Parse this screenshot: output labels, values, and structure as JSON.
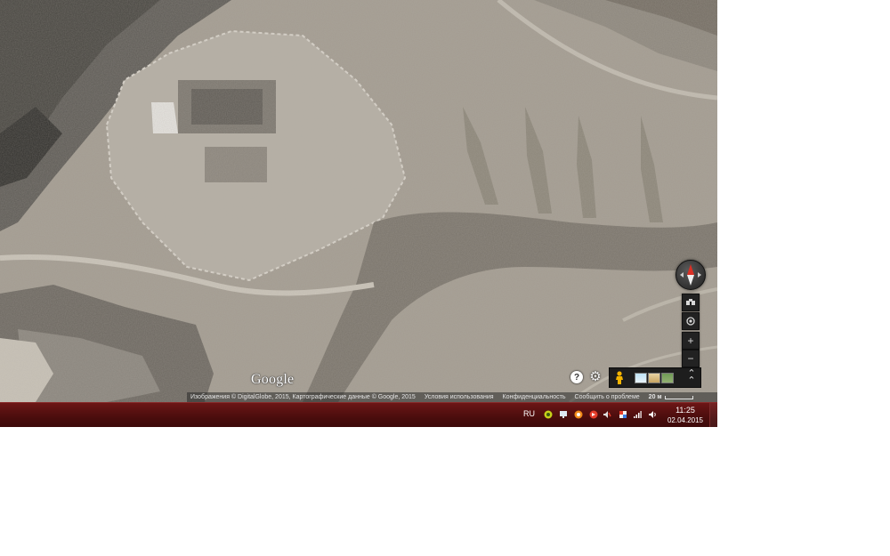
{
  "map": {
    "provider_logo": "Google",
    "attribution": {
      "imagery": "Изображения © DigitalGlobe, 2015, Картографические данные © Google, 2015",
      "terms": "Условия использования",
      "privacy": "Конфиденциальность",
      "report": "Сообщить о проблеме",
      "scale": "20 м"
    },
    "controls": {
      "compass": "compass-icon",
      "tilt": "tilt-icon",
      "locate": "locate-icon",
      "zoom_in": "+",
      "zoom_out": "−",
      "help": "?",
      "settings": "gear-icon",
      "street_view": "pegman-icon",
      "expand": "chevron-up-icon"
    },
    "colors": {
      "compass_north": "#d93025",
      "pegman": "#f4b400"
    }
  },
  "taskbar": {
    "language": "RU",
    "tray_icons": [
      "app-icon-green",
      "display-icon",
      "app-icon-orange",
      "app-icon-red",
      "flag-icon",
      "network-bars-icon",
      "volume-icon"
    ],
    "time": "11:25",
    "date": "02.04.2015",
    "color": "#5a1010"
  }
}
